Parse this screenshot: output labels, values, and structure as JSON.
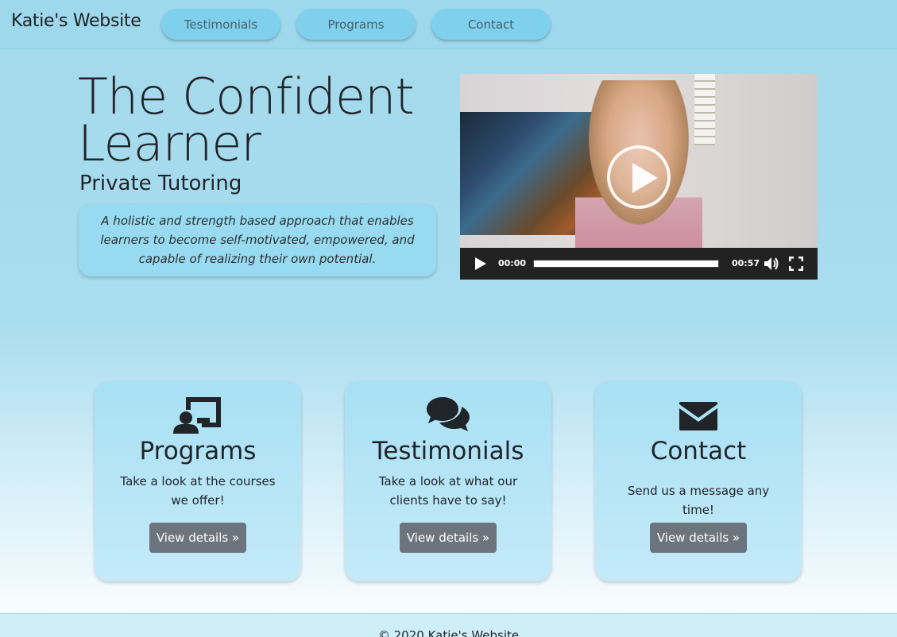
{
  "navbar": {
    "brand": "Katie's Website",
    "links": [
      "Testimonials",
      "Programs",
      "Contact"
    ]
  },
  "hero": {
    "title_line1": "The Confident",
    "title_line2": "Learner",
    "subtitle": "Private Tutoring",
    "description": "A holistic and strength based approach that enables learners to become self-motivated, empowered, and capable of realizing their own potential."
  },
  "video": {
    "current_time": "00:00",
    "duration": "00:57",
    "progress_fraction": 0
  },
  "cards": [
    {
      "icon": "chalkboard-teacher-icon",
      "title": "Programs",
      "text": "Take a look at the courses we offer!",
      "button": "View details »"
    },
    {
      "icon": "comments-icon",
      "title": "Testimonials",
      "text": "Take a look at what our clients have to say!",
      "button": "View details »"
    },
    {
      "icon": "envelope-icon",
      "title": "Contact",
      "text": "Send us a message any time!",
      "button": "View details »"
    }
  ],
  "footer": {
    "text": "© 2020 Katie's Website"
  },
  "colors": {
    "navbar_bg": "#9ed8ec",
    "nav_button": "#7fd0ec",
    "card_button": "#6c757d",
    "video_progress": "#2a8fd8"
  }
}
